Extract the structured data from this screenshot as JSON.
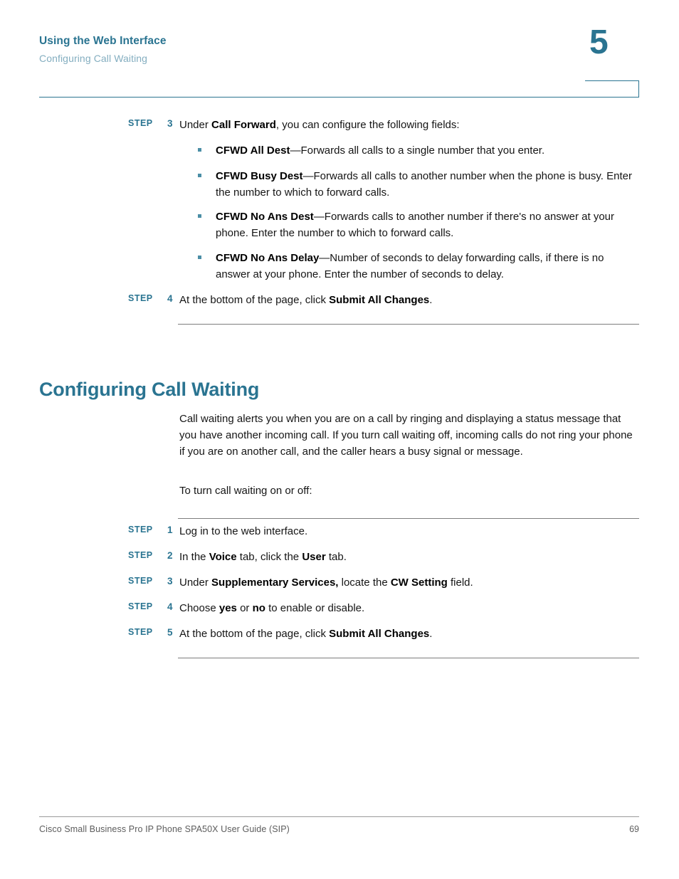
{
  "header": {
    "chapter_title": "Using the Web Interface",
    "section_title": "Configuring Call Waiting",
    "chapter_number": "5"
  },
  "colors": {
    "teal": "#2a7491",
    "light_teal": "#84aec0",
    "bullet": "#4b8ea6",
    "divider_gray": "#7d7d7d",
    "footer_gray": "#5d5d5d",
    "body_text": "#151515"
  },
  "top_section": {
    "step3": {
      "label": "STEP",
      "number": "3",
      "text_html": "Under <b>Call Forward</b>, you can configure the following fields:"
    },
    "bullets": [
      {
        "term": "CFWD All Dest",
        "text_html": "<b>CFWD All Dest</b>—Forwards all calls to a single number that you enter."
      },
      {
        "term": "CFWD Busy Dest",
        "text_html": "<b>CFWD Busy Dest</b>—Forwards all calls to another number when the phone is busy. Enter the number to which to forward calls."
      },
      {
        "term": "CFWD No Ans Dest",
        "text_html": "<b>CFWD No Ans Dest</b>—Forwards calls to another number if there's no answer at your phone. Enter the number to which to forward calls."
      },
      {
        "term": "CFWD No Ans Delay",
        "text_html": "<b>CFWD No Ans Delay</b>—Number of seconds to delay forwarding calls, if there is no answer at your phone. Enter the number of seconds to delay."
      }
    ],
    "step4": {
      "label": "STEP",
      "number": "4",
      "text_html": "At the bottom of the page, click <b>Submit All Changes</b>."
    }
  },
  "section": {
    "heading": "Configuring Call Waiting",
    "paragraph_1": "Call waiting alerts you when you are on a call by ringing and displaying a status message that you have another incoming call. If you turn call waiting off, incoming calls do not ring your phone if you are on another call, and the caller hears a busy signal or message.",
    "paragraph_2": "To turn call waiting on or off:",
    "steps": [
      {
        "label": "STEP",
        "number": "1",
        "text_html": "Log in to the web interface."
      },
      {
        "label": "STEP",
        "number": "2",
        "text_html": "In the <b>Voice</b> tab, click the <b>User</b> tab."
      },
      {
        "label": "STEP",
        "number": "3",
        "text_html": "Under <b>Supplementary Services,</b> locate the <b>CW Setting</b> field."
      },
      {
        "label": "STEP",
        "number": "4",
        "text_html": "Choose <b>yes</b> or <b>no</b> to enable or disable."
      },
      {
        "label": "STEP",
        "number": "5",
        "text_html": "At the bottom of the page, click <b>Submit All Changes</b>."
      }
    ]
  },
  "footer": {
    "text": "Cisco Small Business Pro IP Phone SPA50X User Guide (SIP)",
    "page_number": "69"
  }
}
